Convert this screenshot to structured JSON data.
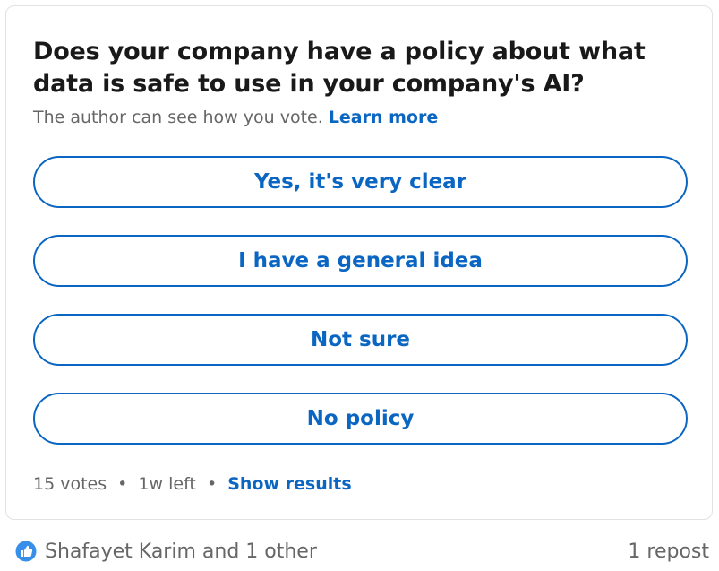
{
  "poll": {
    "question": "Does your company have a policy about what data is safe to use in your company's AI?",
    "visibility_note": "The author can see how you vote.",
    "learn_more_label": "Learn more",
    "options": [
      {
        "label": "Yes, it's very clear"
      },
      {
        "label": "I have a general idea"
      },
      {
        "label": "Not sure"
      },
      {
        "label": "No policy"
      }
    ],
    "votes": "15 votes",
    "time_left": "1w left",
    "separator": "•",
    "show_results_label": "Show results",
    "accent_color": "#0a66c2"
  },
  "social": {
    "reaction_icon": "like-icon",
    "reactions_text": "Shafayet Karim and 1 other",
    "reposts_text": "1 repost"
  }
}
